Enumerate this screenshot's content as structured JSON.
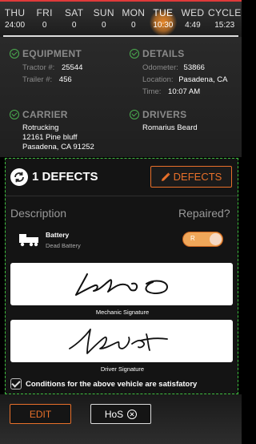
{
  "week": {
    "days": [
      {
        "name": "THU",
        "value": "24:00"
      },
      {
        "name": "FRI",
        "value": "0"
      },
      {
        "name": "SAT",
        "value": "0"
      },
      {
        "name": "SUN",
        "value": "0"
      },
      {
        "name": "MON",
        "value": "0"
      },
      {
        "name": "TUE",
        "value": "10:30"
      },
      {
        "name": "WED",
        "value": "4:49"
      }
    ],
    "cycle": {
      "name": "CYCLE",
      "value": "15:23"
    },
    "active_day": "TUE",
    "accent_color": "#f28c28"
  },
  "equipment": {
    "title": "EQUIPMENT",
    "tractor_label": "Tractor #:",
    "tractor_value": "25544",
    "trailer_label": "Trailer #:",
    "trailer_value": "456"
  },
  "details": {
    "title": "DETAILS",
    "odometer_label": "Odometer:",
    "odometer_value": "53866",
    "location_label": "Location:",
    "location_value": "Pasadena, CA",
    "time_label": "Time:",
    "time_value": "10:07 AM"
  },
  "carrier": {
    "title": "CARRIER",
    "name": "Rotrucking",
    "street": "12161 Pine bluff",
    "city": "Pasadena, CA 91252"
  },
  "drivers": {
    "title": "DRIVERS",
    "name": "Romarius Beard"
  },
  "defects": {
    "count_label": "1 DEFECTS",
    "button_label": "DEFECTS",
    "description_header": "Description",
    "repaired_header": "Repaired?",
    "item": {
      "name": "Battery",
      "description": "Dead Battery",
      "toggle_label": "R",
      "repaired": true
    },
    "mechanic_signature_label": "Mechanic Signature",
    "driver_signature_label": "Driver Signature",
    "conditions_label": "Conditions for the above vehicle are satisfatory"
  },
  "footer": {
    "edit_label": "EDIT",
    "hos_label": "HoS"
  },
  "colors": {
    "accent_orange": "#e8702a",
    "check_green": "#4caf50",
    "dashed_border": "#3fbf3f",
    "header_red": "#e03a3a"
  }
}
